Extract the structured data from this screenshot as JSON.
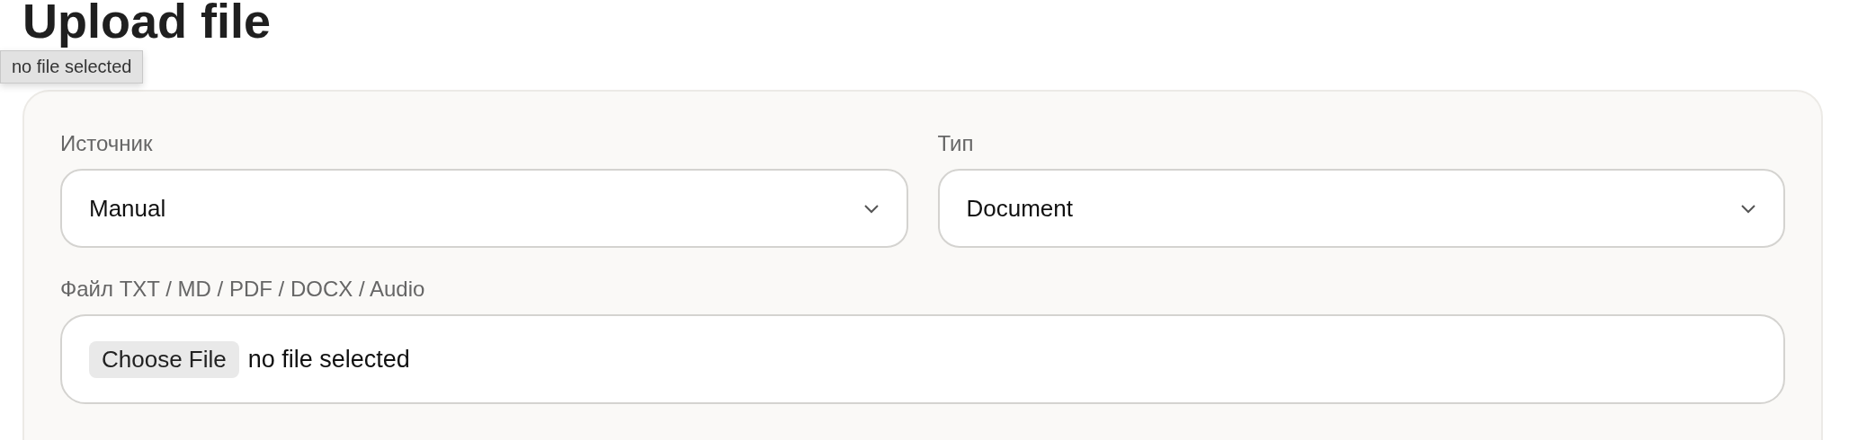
{
  "page_title": "Upload file",
  "tooltip": "no file selected",
  "form": {
    "fields": [
      {
        "kind": "select",
        "label": "Источник",
        "value": "Manual"
      },
      {
        "kind": "select",
        "label": "Тип",
        "value": "Document"
      },
      {
        "kind": "file",
        "label": "Файл TXT / MD / PDF / DOCX / Audio",
        "button": "Choose File",
        "value": "no file selected"
      }
    ]
  }
}
